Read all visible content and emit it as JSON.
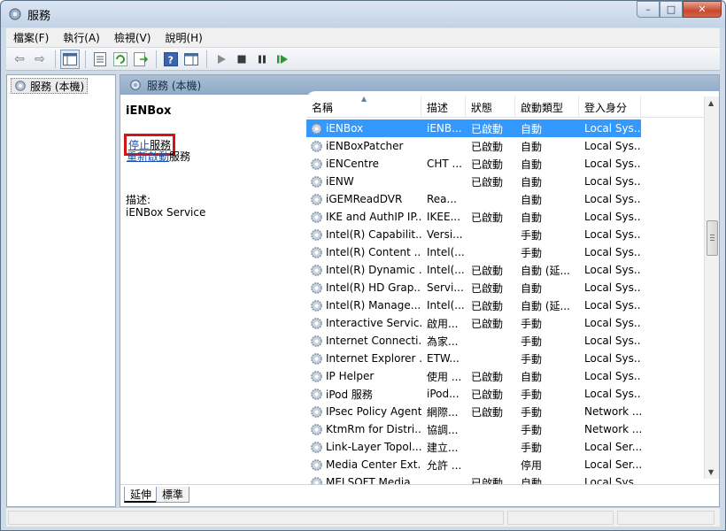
{
  "window": {
    "title": "服務"
  },
  "caption_buttons": {
    "minimize": "–",
    "maximize": "□",
    "close": "✕"
  },
  "menu": [
    "檔案(F)",
    "執行(A)",
    "檢視(V)",
    "說明(H)"
  ],
  "tree": {
    "item": "服務 (本機)"
  },
  "pane": {
    "header": "服務 (本機)"
  },
  "extended": {
    "selected_name": "iENBox",
    "stop_link": "停止",
    "stop_rest": "服務",
    "restart_link": "重新啟動",
    "restart_rest": "服務",
    "desc_label": "描述:",
    "desc_text": "iENBox Service"
  },
  "table": {
    "headers": [
      "名稱",
      "描述",
      "狀態",
      "啟動類型",
      "登入身分"
    ],
    "rows": [
      [
        "iENBox",
        "iENB...",
        "已啟動",
        "自動",
        "Local Sys..."
      ],
      [
        "iENBoxPatcher",
        "",
        "已啟動",
        "自動",
        "Local Sys..."
      ],
      [
        "iENCentre",
        "CHT ...",
        "已啟動",
        "自動",
        "Local Sys..."
      ],
      [
        "iENW",
        "",
        "已啟動",
        "自動",
        "Local Sys..."
      ],
      [
        "iGEMReadDVR",
        "Rea...",
        "",
        "自動",
        "Local Sys..."
      ],
      [
        "IKE and AuthIP IP...",
        "IKEE...",
        "已啟動",
        "自動",
        "Local Sys..."
      ],
      [
        "Intel(R) Capabilit...",
        "Versi...",
        "",
        "手動",
        "Local Sys..."
      ],
      [
        "Intel(R) Content ...",
        "Intel(...",
        "",
        "手動",
        "Local Sys..."
      ],
      [
        "Intel(R) Dynamic ...",
        "Intel(...",
        "已啟動",
        "自動 (延...",
        "Local Sys..."
      ],
      [
        "Intel(R) HD Grap...",
        "Servi...",
        "已啟動",
        "自動",
        "Local Sys..."
      ],
      [
        "Intel(R) Manage...",
        "Intel(...",
        "已啟動",
        "自動 (延...",
        "Local Sys..."
      ],
      [
        "Interactive Servic...",
        "啟用...",
        "已啟動",
        "手動",
        "Local Sys..."
      ],
      [
        "Internet Connecti...",
        "為家...",
        "",
        "手動",
        "Local Sys..."
      ],
      [
        "Internet Explorer ...",
        "ETW...",
        "",
        "手動",
        "Local Sys..."
      ],
      [
        "IP Helper",
        "使用 ...",
        "已啟動",
        "自動",
        "Local Sys..."
      ],
      [
        "iPod 服務",
        "iPod...",
        "已啟動",
        "手動",
        "Local Sys..."
      ],
      [
        "IPsec Policy Agent",
        "網際...",
        "已啟動",
        "手動",
        "Network ..."
      ],
      [
        "KtmRm for Distri...",
        "協調...",
        "",
        "手動",
        "Network ..."
      ],
      [
        "Link-Layer Topol...",
        "建立...",
        "",
        "手動",
        "Local Ser..."
      ],
      [
        "Media Center Ext...",
        "允許 ...",
        "",
        "停用",
        "Local Ser..."
      ],
      [
        "MELSOFT Media...",
        "",
        "已啟動",
        "自動",
        "Local Sys..."
      ]
    ],
    "selected_index": 0
  },
  "tabs": [
    "延伸",
    "標準"
  ],
  "colors": {
    "selection": "#3399ff",
    "highlight_box": "#d21616",
    "link": "#1a4fb3"
  }
}
